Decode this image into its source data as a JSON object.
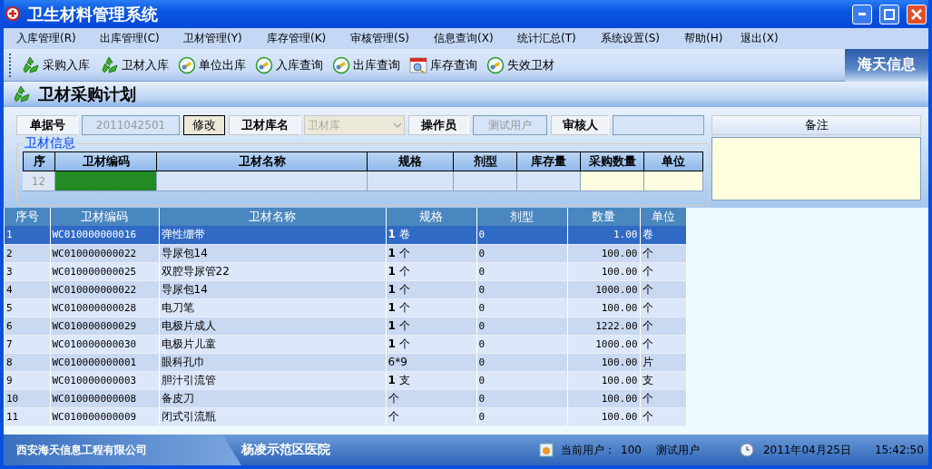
{
  "window": {
    "title": "卫生材料管理系统"
  },
  "menu": [
    {
      "label": "入库管理(R)"
    },
    {
      "label": "出库管理(C)"
    },
    {
      "label": "卫材管理(Y)"
    },
    {
      "label": "库存管理(K)"
    },
    {
      "label": "审核管理(S)"
    },
    {
      "label": "信息查询(X)"
    },
    {
      "label": "统计汇总(T)"
    },
    {
      "label": "系统设置(S)"
    },
    {
      "label": "帮助(H)"
    },
    {
      "label": "退出(X)"
    }
  ],
  "toolbar": [
    {
      "label": "采购入库",
      "kind": "recycle"
    },
    {
      "label": "卫材入库",
      "kind": "recycle"
    },
    {
      "label": "单位出库",
      "kind": "circle"
    },
    {
      "label": "入库查询",
      "kind": "circle"
    },
    {
      "label": "出库查询",
      "kind": "circle"
    },
    {
      "label": "库存查询",
      "kind": "calendar"
    },
    {
      "label": "失效卫材",
      "kind": "circle"
    }
  ],
  "brand": "海天信息",
  "section_title": "卫材采购计划",
  "form": {
    "doc_no_label": "单据号",
    "doc_no": "2011042501",
    "edit_button": "修改",
    "store_label": "卫材库名",
    "store_value": "卫材库",
    "operator_label": "操作员",
    "operator": "测试用户",
    "auditor_label": "审核人",
    "remark_label": "备注"
  },
  "entry": {
    "group_title": "卫材信息",
    "columns": [
      "序",
      "卫材编码",
      "卫材名称",
      "规格",
      "剂型",
      "库存量",
      "采购数量",
      "单位"
    ],
    "row_number": "12"
  },
  "table": {
    "columns": [
      "序号",
      "卫材编码",
      "卫材名称",
      "规格",
      "剂型",
      "数量",
      "单位"
    ],
    "rows": [
      {
        "cells": [
          "1",
          "WC010000000016",
          "弹性绷带",
          "**1** 卷",
          "0",
          "1.00",
          "卷"
        ],
        "selected": true
      },
      {
        "cells": [
          "2",
          "WC010000000022",
          "导尿包14",
          "**1** 个",
          "0",
          "100.00",
          "个"
        ],
        "selected": false
      },
      {
        "cells": [
          "3",
          "WC010000000025",
          "双腔导尿管22",
          "**1** 个",
          "0",
          "100.00",
          "个"
        ],
        "selected": false
      },
      {
        "cells": [
          "4",
          "WC010000000022",
          "导尿包14",
          "**1** 个",
          "0",
          "1000.00",
          "个"
        ],
        "selected": false
      },
      {
        "cells": [
          "5",
          "WC010000000028",
          "电刀笔",
          "**1** 个",
          "0",
          "100.00",
          "个"
        ],
        "selected": false
      },
      {
        "cells": [
          "6",
          "WC010000000029",
          "电极片成人",
          "**1** 个",
          "0",
          "1222.00",
          "个"
        ],
        "selected": false
      },
      {
        "cells": [
          "7",
          "WC010000000030",
          "电极片儿童",
          "**1** 个",
          "0",
          "1000.00",
          "个"
        ],
        "selected": false
      },
      {
        "cells": [
          "8",
          "WC010000000001",
          "眼科孔巾",
          "6*9",
          "0",
          "100.00",
          "片"
        ],
        "selected": false
      },
      {
        "cells": [
          "9",
          "WC010000000003",
          "胆汁引流管",
          "**1** 支",
          "0",
          "100.00",
          "支"
        ],
        "selected": false
      },
      {
        "cells": [
          "10",
          "WC010000000008",
          "备皮刀",
          "个",
          "0",
          "100.00",
          "个"
        ],
        "selected": false
      },
      {
        "cells": [
          "11",
          "WC010000000009",
          "闭式引流瓶",
          "个",
          "0",
          "100.00",
          "个"
        ],
        "selected": false
      }
    ]
  },
  "status_bar": {
    "company": "西安海天信息工程有限公司",
    "hospital": "杨凌示范区医院",
    "user_label": "当前用户：",
    "user_id": "100",
    "user_name": "测试用户",
    "date": "2011年04月25日",
    "time": "15:42:50"
  }
}
